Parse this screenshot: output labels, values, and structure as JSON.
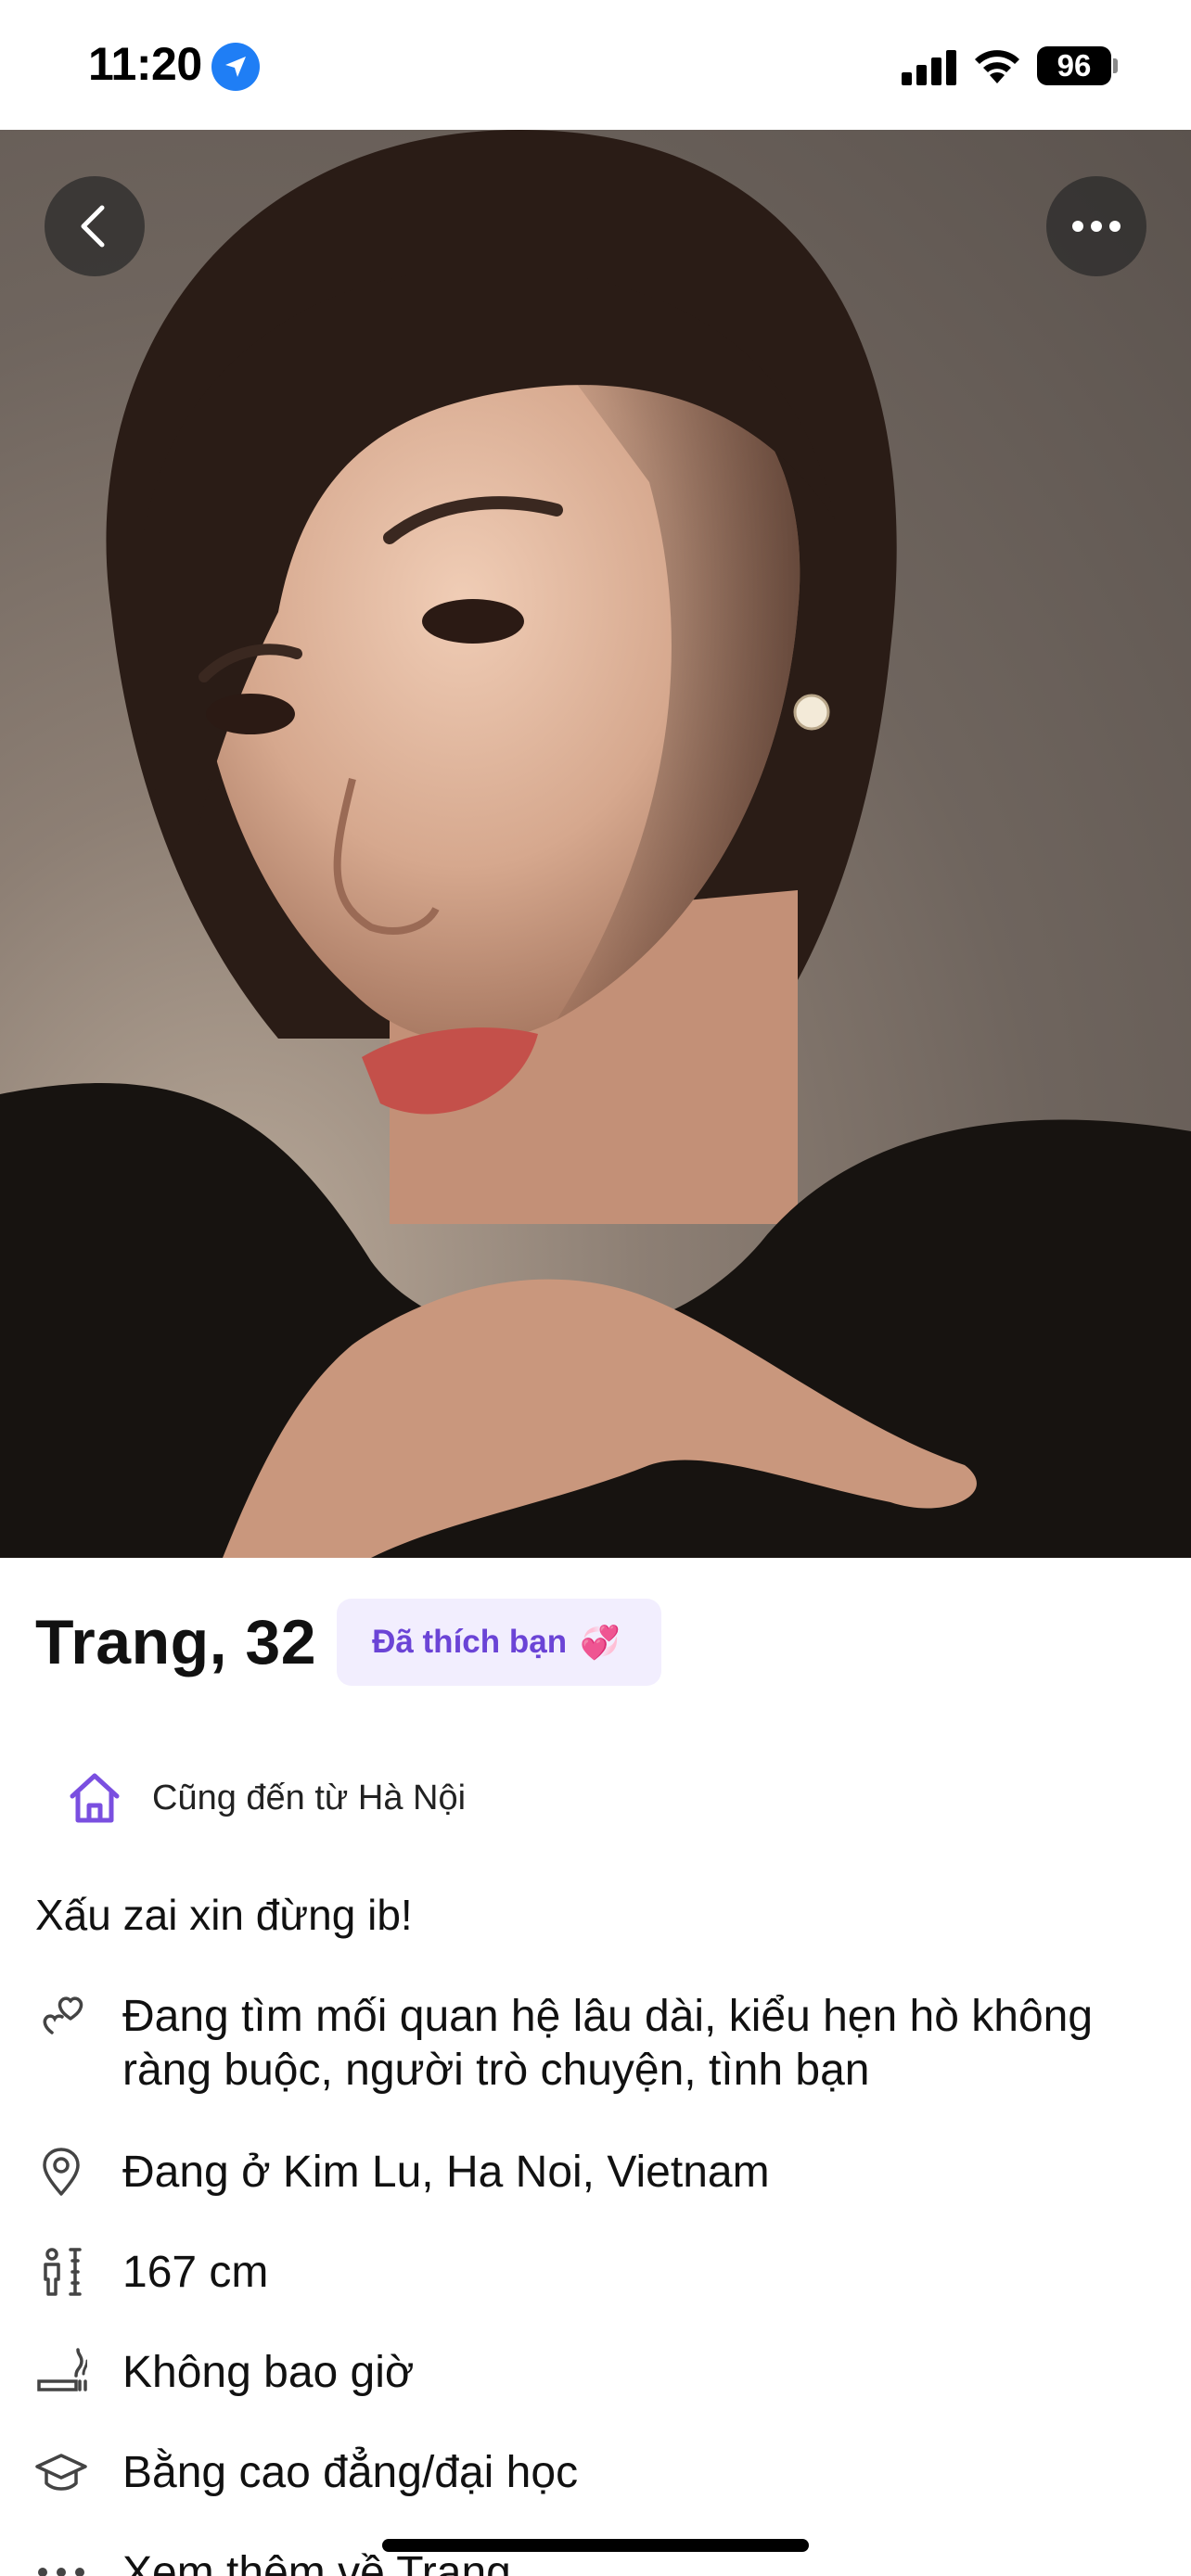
{
  "status_bar": {
    "time": "11:20",
    "battery": "96"
  },
  "profile": {
    "name_age": "Trang, 32",
    "liked_badge": "Đã thích bạn",
    "liked_emoji": "💞",
    "hometown": "Cũng đến từ Hà Nội",
    "bio": "Xấu zai xin đừng ib!",
    "details": [
      {
        "icon": "hearts-icon",
        "text": "Đang tìm mối quan hệ lâu dài, kiểu hẹn hò không ràng buộc, người trò chuyện, tình bạn"
      },
      {
        "icon": "location-pin-icon",
        "text": "Đang ở Kim Lu, Ha Noi, Vietnam"
      },
      {
        "icon": "height-icon",
        "text": "167 cm"
      },
      {
        "icon": "smoking-icon",
        "text": "Không bao giờ"
      },
      {
        "icon": "graduation-cap-icon",
        "text": "Bằng cao đẳng/đại học"
      },
      {
        "icon": "more-dots-icon",
        "text": "Xem thêm về Trang"
      }
    ]
  },
  "colors": {
    "accent": "#6b44d6",
    "badge_bg": "#f2eefe",
    "location_blue": "#1f7ef5"
  }
}
